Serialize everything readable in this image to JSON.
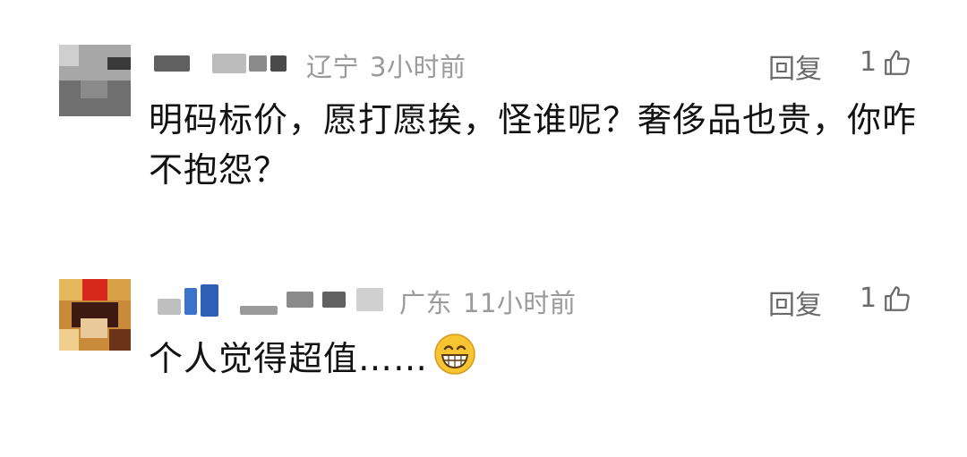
{
  "comments": [
    {
      "location": "辽宁",
      "time": "3小时前",
      "reply_label": "回复",
      "like_count": "1",
      "text": "明码标价，愿打愿挨，怪谁呢？奢侈品也贵，你咋不抱怨？"
    },
    {
      "location": "广东",
      "time": "11小时前",
      "reply_label": "回复",
      "like_count": "1",
      "text": "个人觉得超值……",
      "emoji": "grinning-face-emoji"
    }
  ],
  "icons": {
    "like": "thumbs-up-icon"
  }
}
